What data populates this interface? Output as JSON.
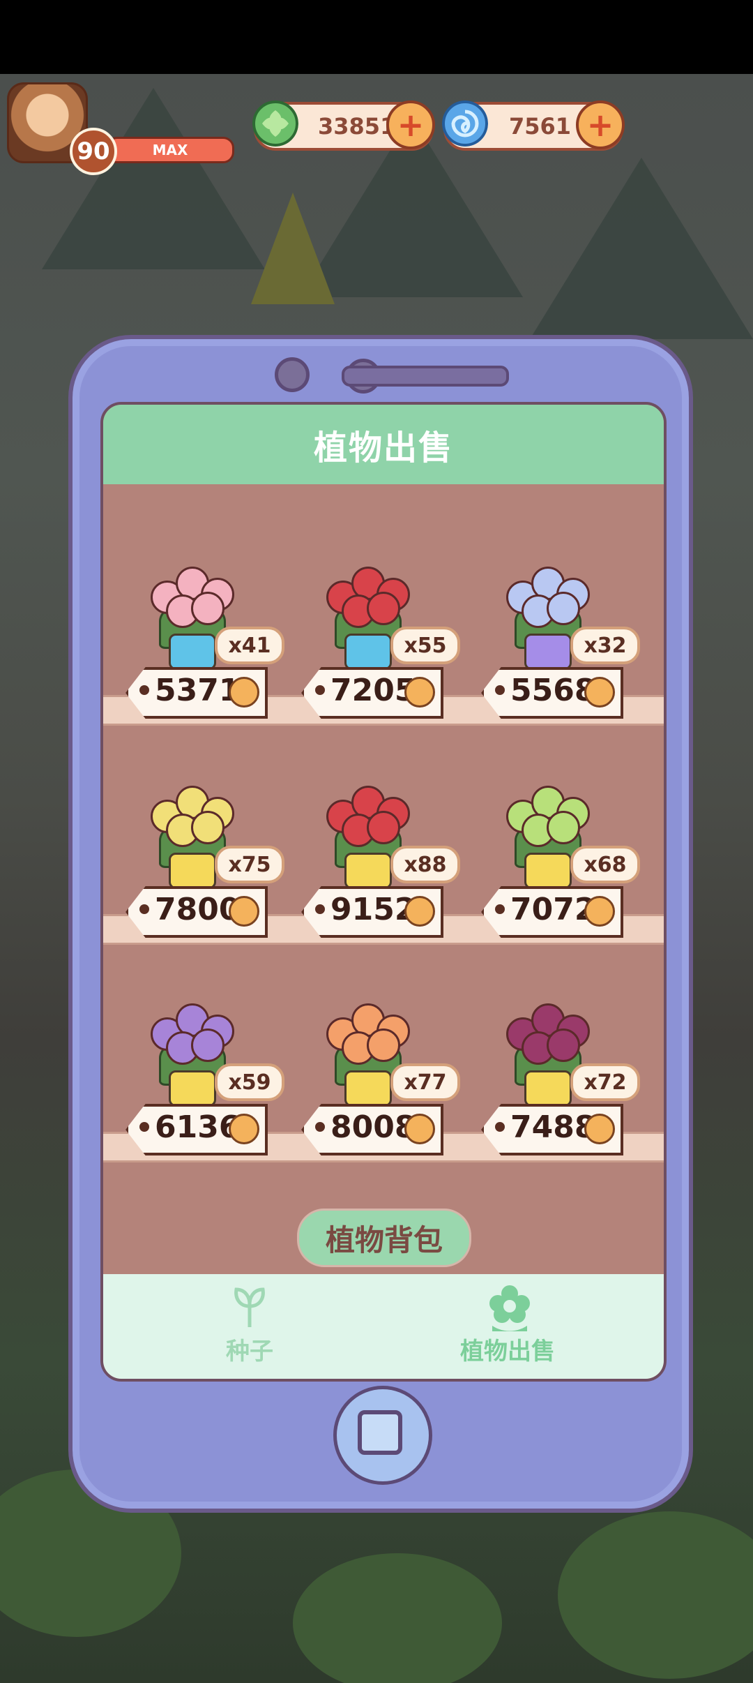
{
  "hud": {
    "level": "90",
    "level_bar_text": "MAX",
    "currency_green": "33851",
    "currency_blue": "7561"
  },
  "phone": {
    "title": "植物出售",
    "items": [
      {
        "count": "x41",
        "price": "5371",
        "flower_color": "#f4b2c0",
        "bow_color": "#5fc3e8"
      },
      {
        "count": "x55",
        "price": "7205",
        "flower_color": "#d8434a",
        "bow_color": "#5fc3e8"
      },
      {
        "count": "x32",
        "price": "5568",
        "flower_color": "#b9c8f2",
        "bow_color": "#a58de8"
      },
      {
        "count": "x75",
        "price": "7800",
        "flower_color": "#f1df78",
        "bow_color": "#f5d95a"
      },
      {
        "count": "x88",
        "price": "9152",
        "flower_color": "#d8434a",
        "bow_color": "#f5d95a"
      },
      {
        "count": "x68",
        "price": "7072",
        "flower_color": "#b8e07a",
        "bow_color": "#f5d95a"
      },
      {
        "count": "x59",
        "price": "6136",
        "flower_color": "#a784d8",
        "bow_color": "#f5d95a"
      },
      {
        "count": "x77",
        "price": "8008",
        "flower_color": "#f4a06a",
        "bow_color": "#f5d95a"
      },
      {
        "count": "x72",
        "price": "7488",
        "flower_color": "#9a3a6a",
        "bow_color": "#f5d95a"
      }
    ],
    "bag_button": "植物背包",
    "tabs": [
      {
        "label": "种子",
        "icon": "sprout-icon"
      },
      {
        "label": "植物出售",
        "icon": "flower-icon"
      }
    ]
  },
  "colors": {
    "header_green": "#8fd3a9",
    "phone_body": "#8c92d6",
    "wood": "#b4837a"
  }
}
